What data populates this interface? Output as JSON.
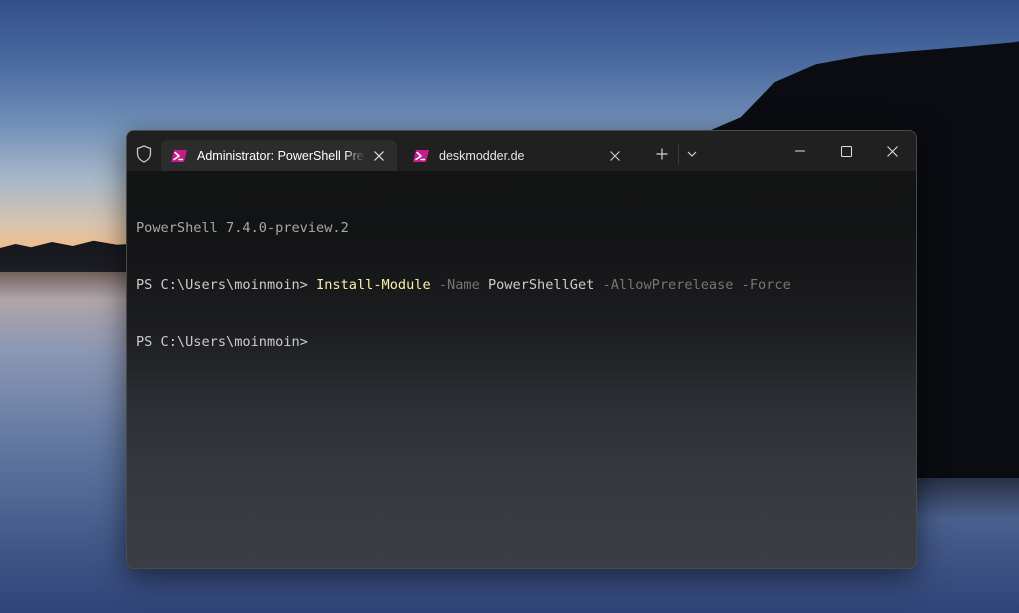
{
  "window": {
    "tabs": [
      {
        "title": "Administrator: PowerShell Preview",
        "active": true,
        "icon": "powershell-icon"
      },
      {
        "title": "deskmodder.de",
        "active": false,
        "icon": "powershell-icon"
      }
    ],
    "icons": {
      "admin": "shield-icon",
      "new_tab": "plus-icon",
      "dropdown": "chevron-down-icon",
      "minimize": "minimize-icon",
      "maximize": "maximize-icon",
      "close": "close-icon"
    },
    "colors": {
      "titlebar": "#202020",
      "active_tab": "#2c2c2c",
      "command": "#f9f1a5",
      "parameter": "#767676",
      "text": "#cccccc",
      "powershell_icon": "#c41c8a"
    }
  },
  "console": {
    "banner": "PowerShell 7.4.0-preview.2",
    "prompt": "PS C:\\Users\\moinmoin> ",
    "command": {
      "cmdlet": "Install-Module",
      "param_name": "-Name",
      "name_value": "PowerShellGet",
      "param_allow": "-AllowPrerelease",
      "param_force": "-Force"
    },
    "prompt2": "PS C:\\Users\\moinmoin>"
  }
}
